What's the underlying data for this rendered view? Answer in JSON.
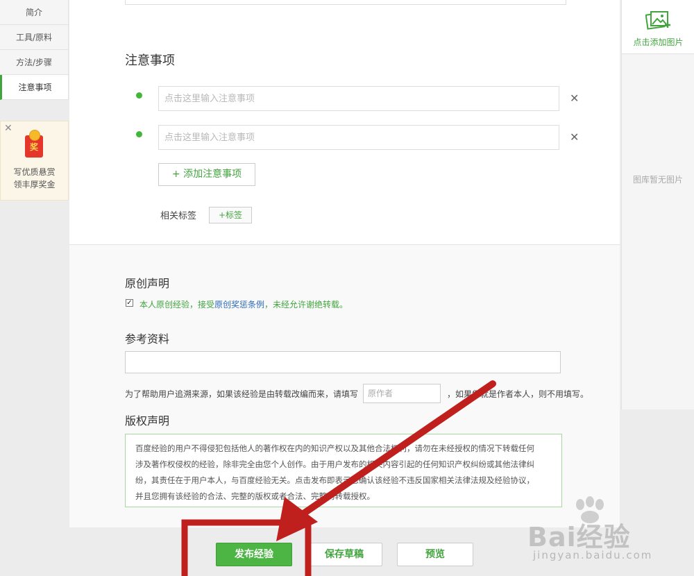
{
  "left_nav": {
    "items": [
      {
        "label": "简介"
      },
      {
        "label": "工具/原料"
      },
      {
        "label": "方法/步骤"
      },
      {
        "label": "注意事项",
        "active": true
      }
    ]
  },
  "promo": {
    "badge": "奖",
    "line1": "写优质悬赏",
    "line2": "领丰厚奖金",
    "close": "✕"
  },
  "notes": {
    "title": "注意事项",
    "placeholder": "点击这里输入注意事项",
    "delete_glyph": "✕",
    "add_label": "+ 添加注意事项"
  },
  "tags": {
    "label": "相关标签",
    "button": "+标签"
  },
  "original": {
    "title": "原创声明",
    "checked": true,
    "text_before": "本人原创经验，接受",
    "link": "原创奖惩条例",
    "text_after": "，未经允许谢绝转载。"
  },
  "reference": {
    "title": "参考资料",
    "hint_before": "为了帮助用户追溯来源，如果该经验是由转载改编而来，请填写",
    "author_placeholder": "原作者",
    "hint_after": "，如果您就是作者本人，则不用填写。"
  },
  "copyright": {
    "title": "版权声明",
    "lines": [
      "百度经验的用户不得侵犯包括他人的著作权在内的知识产权以及其他合法权利，请勿在未经授权的情况下转载任何",
      "涉及著作权侵权的经验，除非完全由您个人创作。由于用户发布的相关内容引起的任何知识产权纠纷或其他法律纠",
      "纷，其责任在于用户本人，与百度经验无关。点击发布即表示您确认该经验不违反国家相关法律法规及经验协议，",
      "并且您拥有该经验的合法、完整的版权或者合法、完整的转载授权。"
    ]
  },
  "right_panel": {
    "add_pic_label": "点击添加图片",
    "empty_text": "图库暂无图片"
  },
  "actions": {
    "publish": "发布经验",
    "save_draft": "保存草稿",
    "preview": "预览"
  },
  "colors": {
    "accent_green": "#43a43f",
    "publish_green": "#4cb543",
    "annotation_red": "#c0201d"
  },
  "watermark": {
    "brand": "Bai经验",
    "url": "jingyan.baidu.com"
  }
}
